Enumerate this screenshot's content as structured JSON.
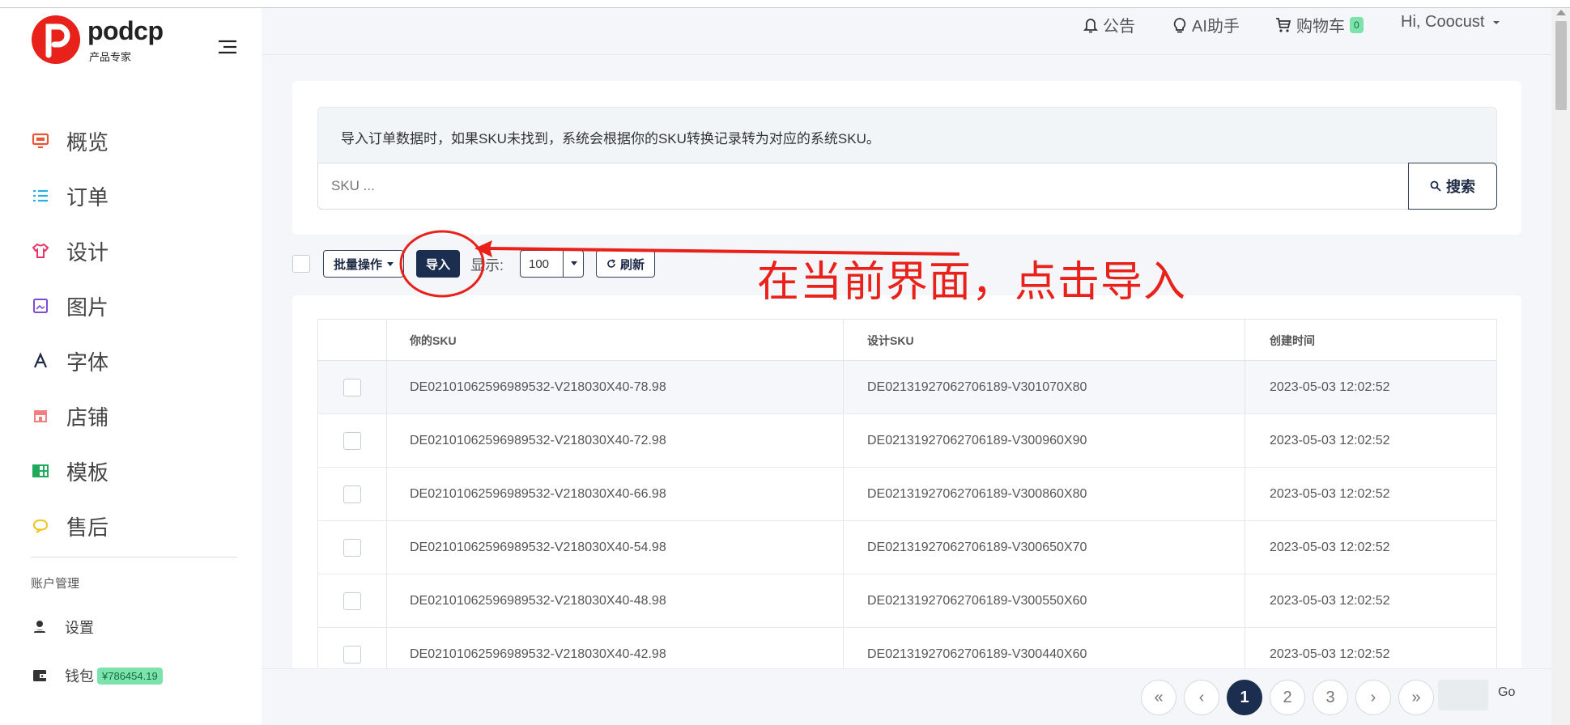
{
  "brand": {
    "name_main": "podcp",
    "subtitle": "产品专家",
    "color": "#e8211a"
  },
  "sidebar": {
    "items": [
      {
        "label": "概览",
        "icon": "monitor-icon",
        "color": "#e8563a"
      },
      {
        "label": "订单",
        "icon": "list-icon",
        "color": "#27b0e6"
      },
      {
        "label": "设计",
        "icon": "shirt-icon",
        "color": "#e8346a"
      },
      {
        "label": "图片",
        "icon": "image-icon",
        "color": "#7a4fcf"
      },
      {
        "label": "字体",
        "icon": "font-icon",
        "color": "#1f2a44"
      },
      {
        "label": "店铺",
        "icon": "store-icon",
        "color": "#f08080"
      },
      {
        "label": "模板",
        "icon": "spreadsheet-icon",
        "color": "#1eaa5a"
      },
      {
        "label": "售后",
        "icon": "chat-bubble-icon",
        "color": "#f0c419"
      }
    ],
    "account_title": "账户管理",
    "settings_label": "设置",
    "wallet_label": "钱包",
    "wallet_balance": "¥786454.19"
  },
  "header": {
    "notice_label": "公告",
    "ai_label": "AI助手",
    "cart_label": "购物车",
    "cart_count": "0",
    "user_label": "Hi, Coocust"
  },
  "notice_text": "导入订单数据时，如果SKU未找到，系统会根据你的SKU转换记录转为对应的系统SKU。",
  "search": {
    "placeholder": "SKU ...",
    "button_label": "搜索"
  },
  "toolbar": {
    "batch_label": "批量操作",
    "import_label": "导入",
    "show_label": "显示:",
    "page_size": "100",
    "refresh_label": "刷新"
  },
  "annotation": {
    "text": "在当前界面，点击导入",
    "color": "#e8211a"
  },
  "table": {
    "columns": [
      "你的SKU",
      "设计SKU",
      "创建时间"
    ],
    "rows": [
      [
        "DE02101062596989532-V218030X40-78.98",
        "DE02131927062706189-V301070X80",
        "2023-05-03 12:02:52"
      ],
      [
        "DE02101062596989532-V218030X40-72.98",
        "DE02131927062706189-V300960X90",
        "2023-05-03 12:02:52"
      ],
      [
        "DE02101062596989532-V218030X40-66.98",
        "DE02131927062706189-V300860X80",
        "2023-05-03 12:02:52"
      ],
      [
        "DE02101062596989532-V218030X40-54.98",
        "DE02131927062706189-V300650X70",
        "2023-05-03 12:02:52"
      ],
      [
        "DE02101062596989532-V218030X40-48.98",
        "DE02131927062706189-V300550X60",
        "2023-05-03 12:02:52"
      ],
      [
        "DE02101062596989532-V218030X40-42.98",
        "DE02131927062706189-V300440X60",
        "2023-05-03 12:02:52"
      ]
    ]
  },
  "pagination": {
    "first": "«",
    "prev": "‹",
    "pages": [
      "1",
      "2",
      "3"
    ],
    "next": "›",
    "last": "»",
    "current": "1",
    "go_label": "Go"
  }
}
